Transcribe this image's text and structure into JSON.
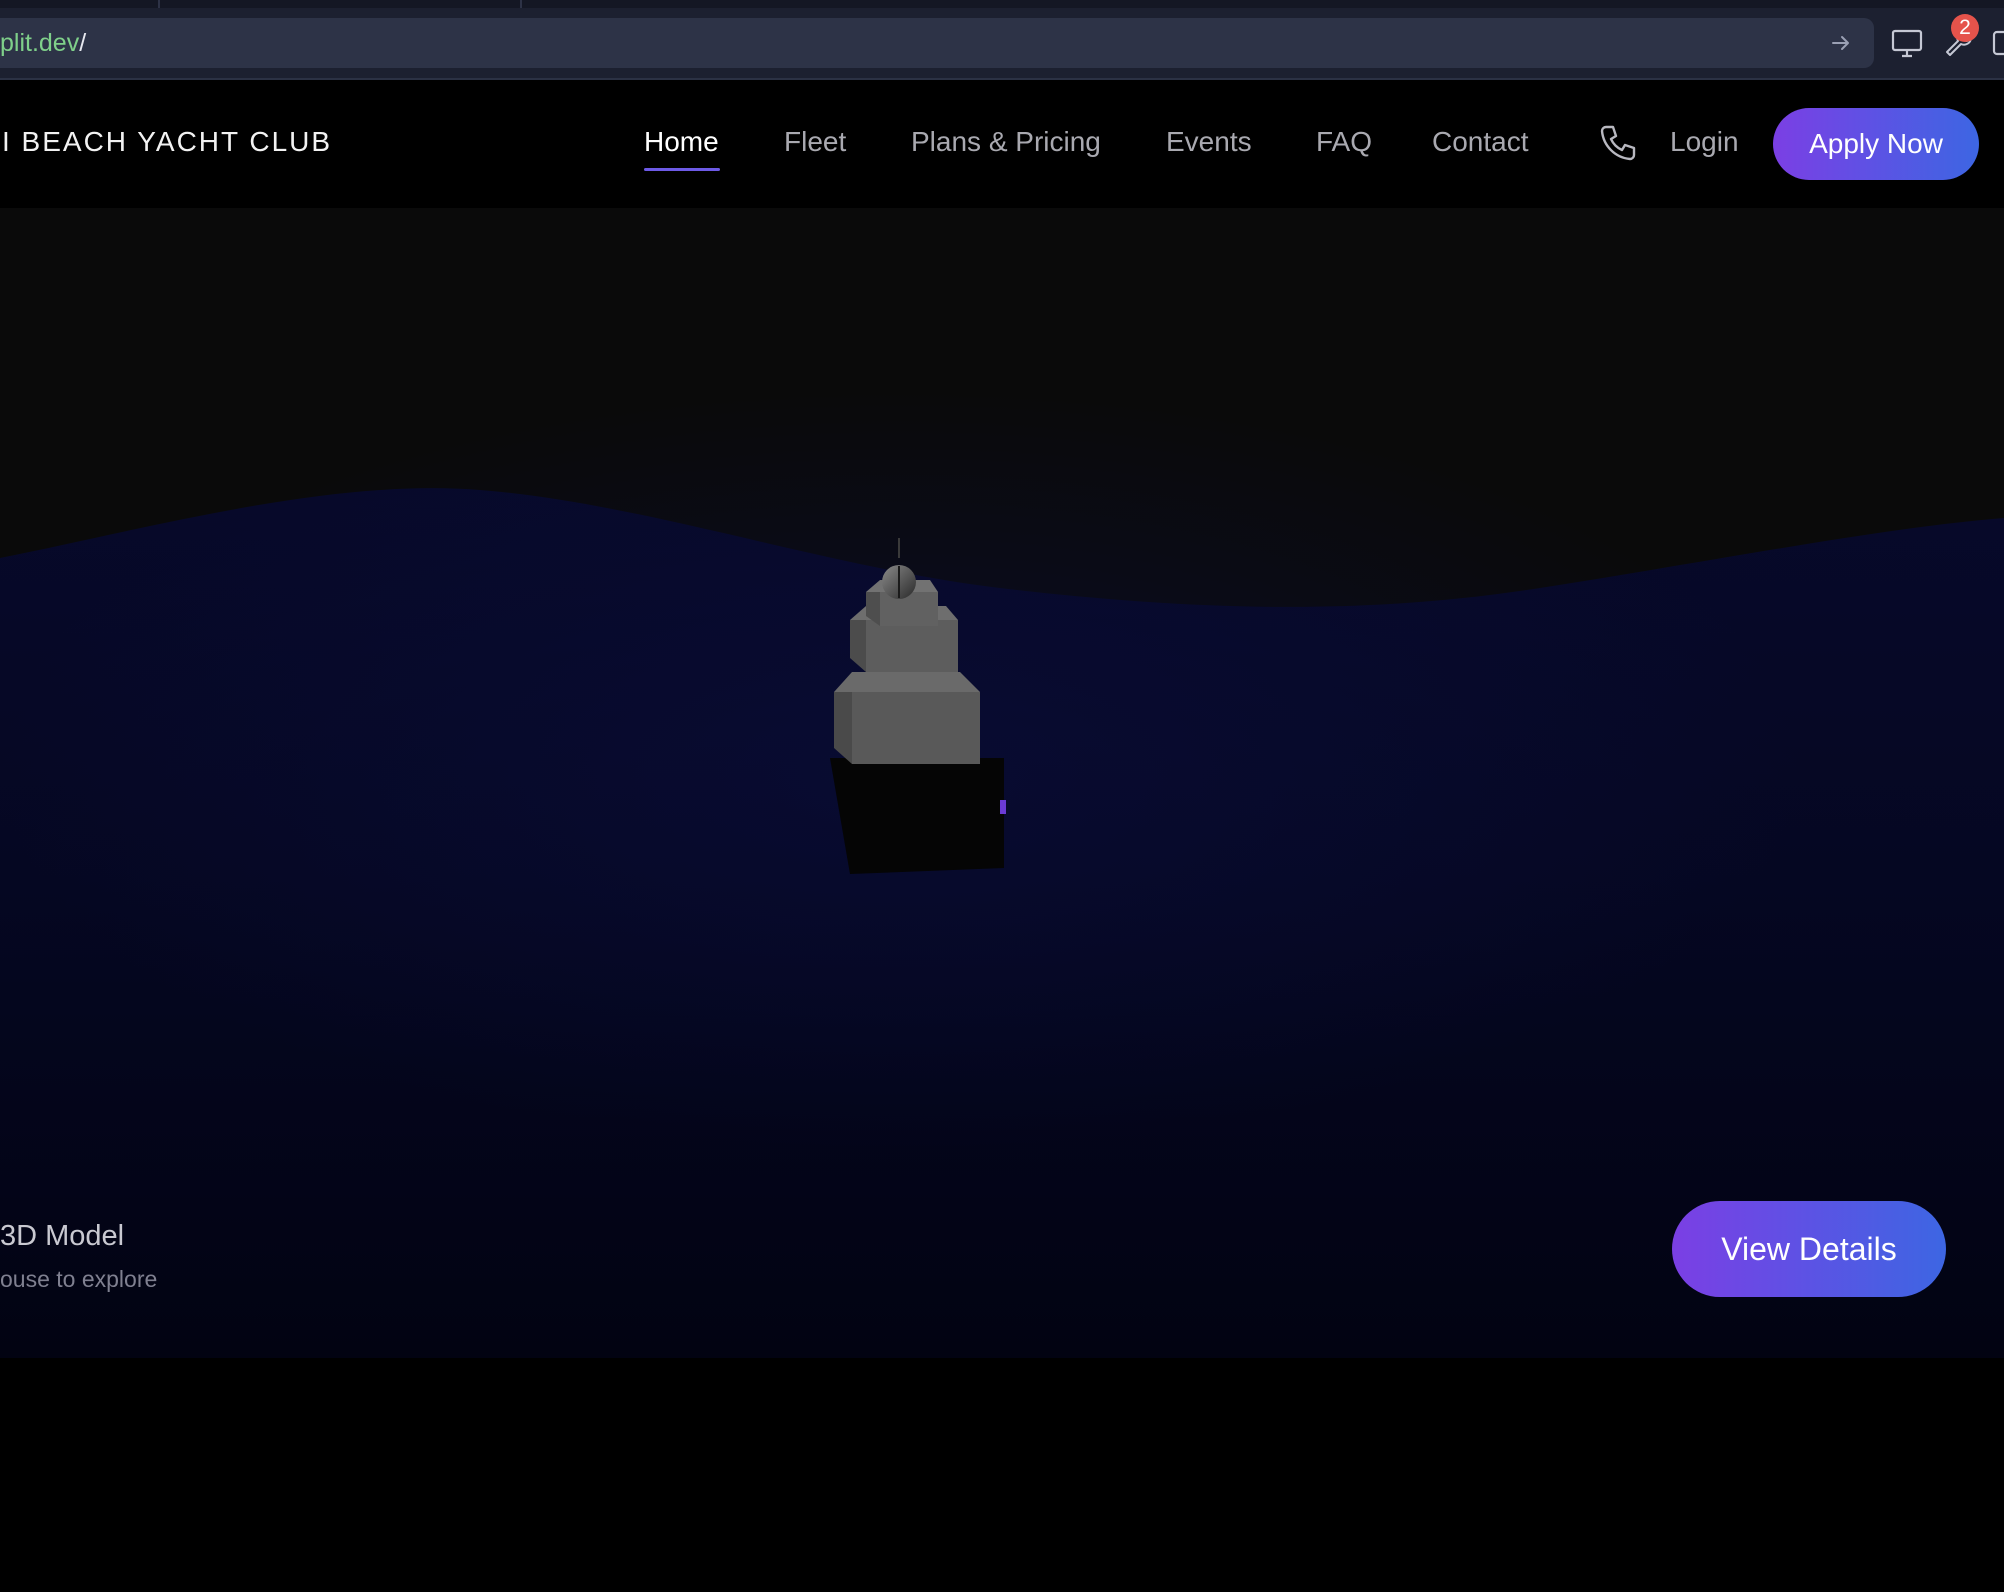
{
  "browser": {
    "url_domain": "plit.dev",
    "url_path": "/",
    "notification_count": "2",
    "icons": [
      "go-arrow-icon",
      "monitor-icon",
      "wrench-icon",
      "panel-icon"
    ]
  },
  "nav": {
    "brand": "I BEACH YACHT CLUB",
    "links": [
      "Home",
      "Fleet",
      "Plans & Pricing",
      "Events",
      "FAQ",
      "Contact"
    ],
    "active_link": "Home",
    "login": "Login",
    "apply": "Apply Now",
    "phone_icon": "phone-icon"
  },
  "hero": {
    "model_title": "3D Model",
    "model_hint": "ouse to explore",
    "details_button": "View Details"
  },
  "colors": {
    "accent_start": "#7b3fe4",
    "accent_end": "#3d66e3",
    "url_domain": "#7fd08a",
    "badge": "#e5534b",
    "water": "#070b2a"
  }
}
